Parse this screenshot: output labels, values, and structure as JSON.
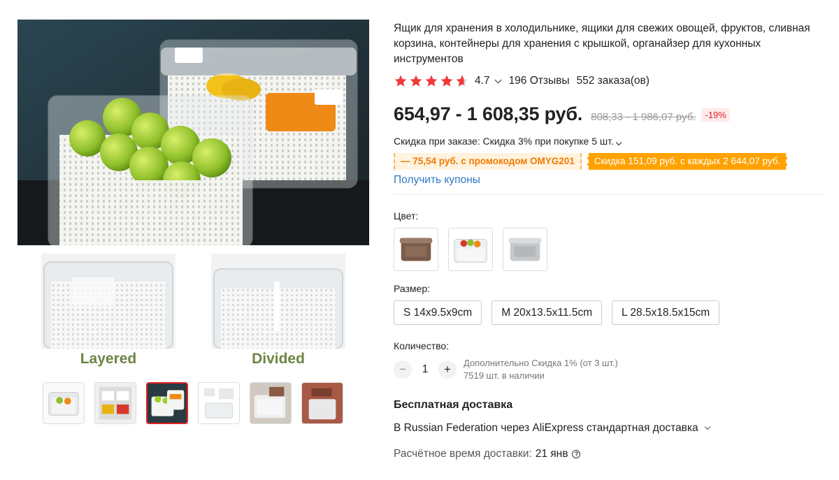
{
  "gallery": {
    "captions": [
      "Layered",
      "Divided"
    ],
    "thumb_count": 6,
    "active_thumb": 3
  },
  "product": {
    "title": "Ящик для хранения в холодильнике, ящики для свежих овощей, фруктов, сливная корзина, контейнеры для хранения с крышкой, органайзер для кухонных инструментов",
    "rating": "4.7",
    "rating_value": 4.7,
    "reviews": "196 Отзывы",
    "orders": "552 заказа(ов)",
    "price": "654,97 - 1 608,35 руб.",
    "old_price": "808,33 - 1 986,07 руб.",
    "discount": "-19%",
    "order_discount": "Скидка при заказе: Скидка 3% при покупке 5 шт.",
    "promo_code": "— 75,54 руб. с промокодом OMYG201",
    "promo_threshold": "Скидка 151,09 руб. с каждых 2 644,07 руб.",
    "coupons_link": "Получить купоны"
  },
  "options": {
    "color_label": "Цвет:",
    "colors": [
      "brown-container",
      "clear-container-with-vegetables",
      "grey-container"
    ],
    "size_label": "Размер:",
    "sizes": [
      "S 14x9.5x9cm",
      "M 20x13.5x11.5cm",
      "L 28.5x18.5x15cm"
    ],
    "quantity_label": "Количество:",
    "quantity": "1",
    "minus": "−",
    "plus": "+",
    "qty_discount": "Дополнительно Скидка 1% (от 3 шт.)",
    "stock": "7519 шт. в наличии"
  },
  "shipping": {
    "title": "Бесплатная доставка",
    "method": "В Russian Federation через AliExpress стандартная доставка",
    "eta_label": "Расчётное время доставки:",
    "eta_date": "21 янв",
    "help": "?"
  },
  "colors": {
    "price_red": "#e02020",
    "promo_orange": "#ffa200",
    "link_blue": "#2e79c4",
    "star_red": "#f03a3a",
    "caption_green": "#6d8443"
  }
}
